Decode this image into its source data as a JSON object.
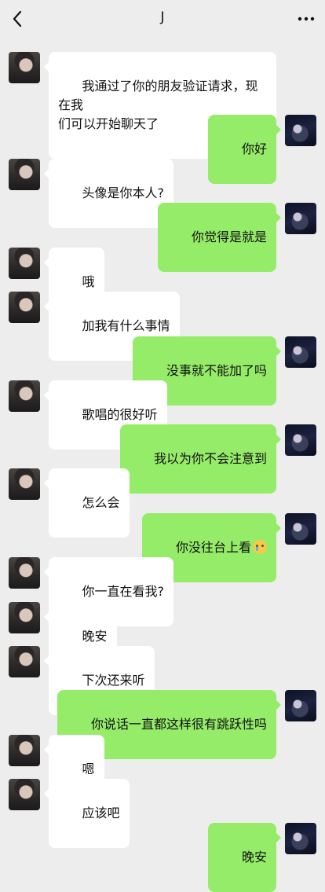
{
  "header": {
    "title": "J",
    "back_icon": "chevron-left-icon",
    "more_icon": "more-dots-icon"
  },
  "colors": {
    "background": "#ededed",
    "sent_bubble": "#95ec69",
    "received_bubble": "#ffffff"
  },
  "messages": [
    {
      "side": "left",
      "text": "我通过了你的朋友验证请求，现在我\n们可以开始聊天了"
    },
    {
      "side": "right",
      "text": "你好"
    },
    {
      "side": "left",
      "text": "头像是你本人?"
    },
    {
      "side": "right",
      "text": "你觉得是就是"
    },
    {
      "side": "left",
      "text": "哦"
    },
    {
      "side": "left",
      "text": "加我有什么事情"
    },
    {
      "side": "right",
      "text": "没事就不能加了吗"
    },
    {
      "side": "left",
      "text": "歌唱的很好听"
    },
    {
      "side": "right",
      "text": "我以为你不会注意到"
    },
    {
      "side": "left",
      "text": "怎么会"
    },
    {
      "side": "right",
      "text": "你没往台上看",
      "emoji": "crying-face-emoji"
    },
    {
      "side": "left",
      "text": "你一直在看我?"
    },
    {
      "side": "left",
      "text": "晚安"
    },
    {
      "side": "left",
      "text": "下次还来听"
    },
    {
      "side": "right",
      "text": "你说话一直都这样很有跳跃性吗"
    },
    {
      "side": "left",
      "text": "嗯"
    },
    {
      "side": "left",
      "text": "应该吧"
    },
    {
      "side": "right",
      "text": "晚安"
    }
  ]
}
